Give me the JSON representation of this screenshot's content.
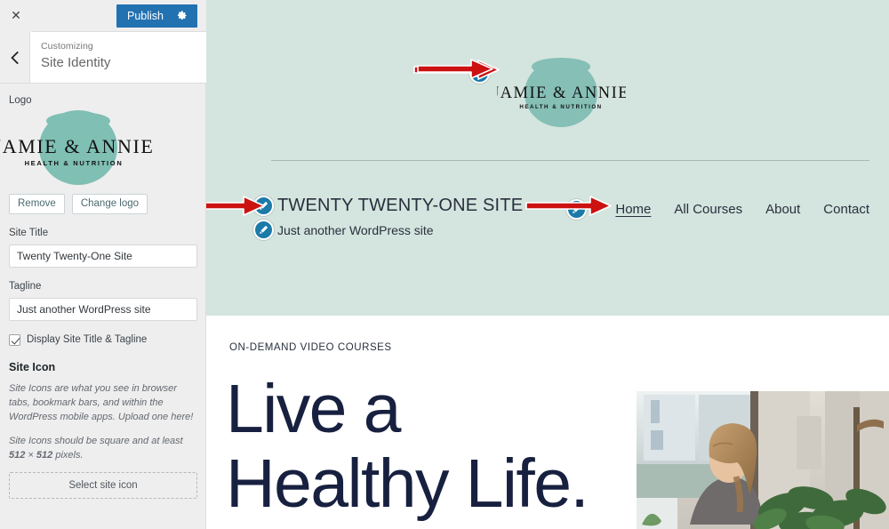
{
  "customizer": {
    "close_label": "Close customizer",
    "publish_label": "Publish",
    "gear_label": "settings-gear",
    "back_label": "Back",
    "eyebrow": "Customizing",
    "panel_title": "Site Identity"
  },
  "sidebar": {
    "logo_label": "Logo",
    "logo": {
      "name_text": "JAMIE & ANNIE",
      "sub_text": "HEALTH & NUTRITION",
      "blob_color": "#7fbfb4"
    },
    "remove_label": "Remove",
    "change_logo_label": "Change logo",
    "site_title_label": "Site Title",
    "site_title_value": "Twenty Twenty-One Site",
    "tagline_label": "Tagline",
    "tagline_value": "Just another WordPress site",
    "display_checkbox_label": "Display Site Title & Tagline",
    "display_checkbox_checked": true,
    "site_icon_heading": "Site Icon",
    "site_icon_help_1": "Site Icons are what you see in browser tabs, bookmark bars, and within the WordPress mobile apps. Upload one here!",
    "site_icon_help_2_pre": "Site Icons should be square and at least ",
    "site_icon_help_2_dim1": "512",
    "site_icon_help_2_mid": " × ",
    "site_icon_help_2_dim2": "512",
    "site_icon_help_2_post": " pixels.",
    "select_site_icon_label": "Select site icon"
  },
  "preview": {
    "header_bg": "#d4e4de",
    "logo": {
      "name_text": "JAMIE & ANNIE",
      "sub_text": "HEALTH & NUTRITION"
    },
    "site_title": "TWENTY TWENTY-ONE SITE",
    "site_tagline": "Just another WordPress site",
    "nav": [
      {
        "label": "Home",
        "current": true
      },
      {
        "label": "All Courses",
        "current": false
      },
      {
        "label": "About",
        "current": false
      },
      {
        "label": "Contact",
        "current": false
      }
    ],
    "hero": {
      "eyebrow": "ON-DEMAND VIDEO COURSES",
      "title_line_1": "Live a",
      "title_line_2": "Healthy Life.",
      "photo_alt": "woman-in-bright-room-with-plants"
    },
    "edit_shortcuts": [
      {
        "name": "edit-logo-pencil"
      },
      {
        "name": "edit-site-title-pencil"
      },
      {
        "name": "edit-tagline-pencil"
      },
      {
        "name": "edit-navigation-pencil"
      }
    ]
  },
  "annotations": {
    "arrow_color": "#cc1111",
    "arrows": [
      {
        "name": "arrow-to-logo-edit"
      },
      {
        "name": "arrow-to-site-title-edit"
      },
      {
        "name": "arrow-to-navigation-edit"
      }
    ]
  }
}
